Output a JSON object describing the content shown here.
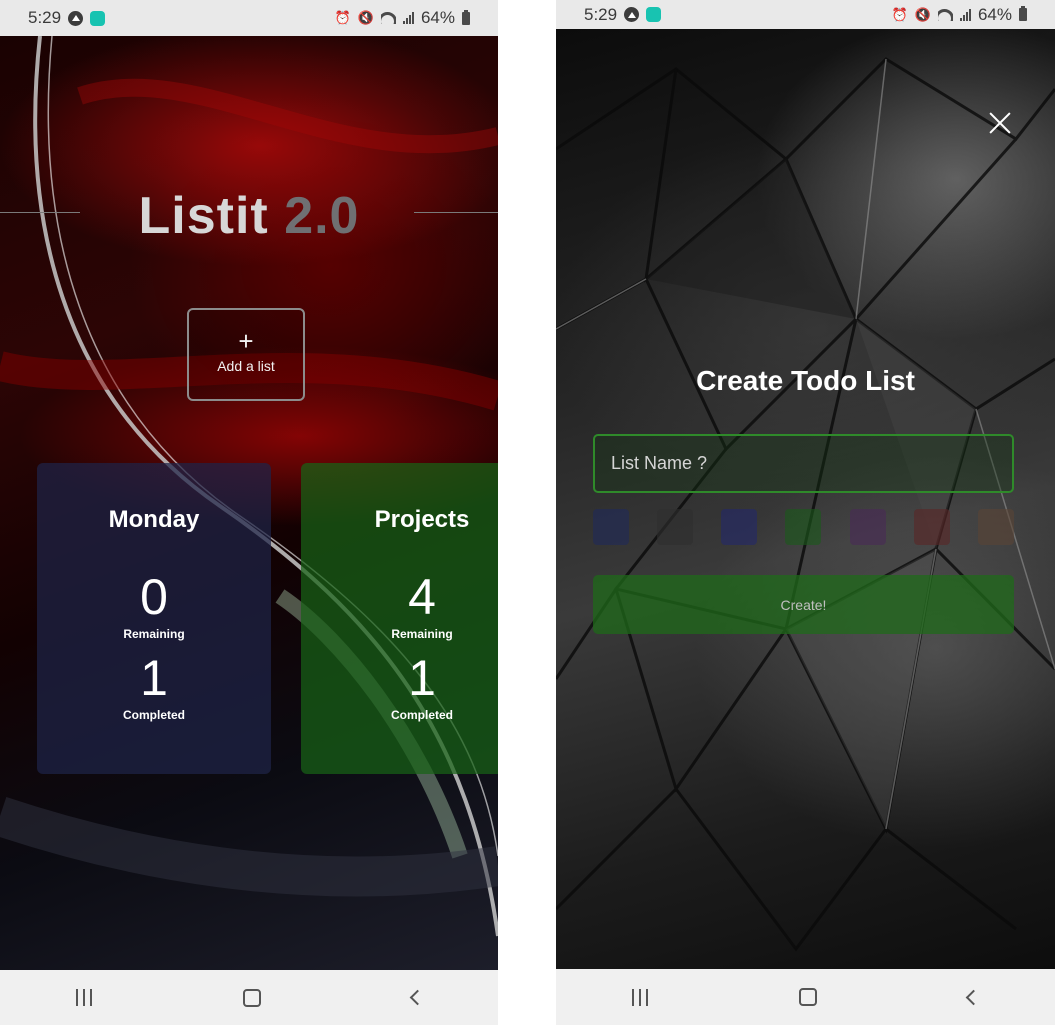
{
  "status_bar": {
    "time": "5:29",
    "battery": "64%"
  },
  "home": {
    "brand_name": "Listit",
    "brand_version": "2.0",
    "add_list": {
      "icon": "plus-icon",
      "symbol": "+",
      "label": "Add a list"
    },
    "lists": [
      {
        "title": "Monday",
        "remaining": "0",
        "remaining_label": "Remaining",
        "completed": "1",
        "completed_label": "Completed",
        "color": "#1e2448"
      },
      {
        "title": "Projects",
        "remaining": "4",
        "remaining_label": "Remaining",
        "completed": "1",
        "completed_label": "Completed",
        "color": "#186216"
      }
    ]
  },
  "create_modal": {
    "close_icon": "close-icon",
    "title": "Create Todo List",
    "input_placeholder": "List Name ?",
    "color_options": [
      "#1f2a5a",
      "#2e2e2e",
      "#23286b",
      "#1a5a1a",
      "#4a2a56",
      "#5a2626",
      "#5a4436"
    ],
    "create_label": "Create!",
    "create_color": "#1f6a1a"
  },
  "nav_bar": {
    "recents_icon": "recents-icon",
    "home_icon": "home-icon",
    "back_icon": "back-icon"
  }
}
